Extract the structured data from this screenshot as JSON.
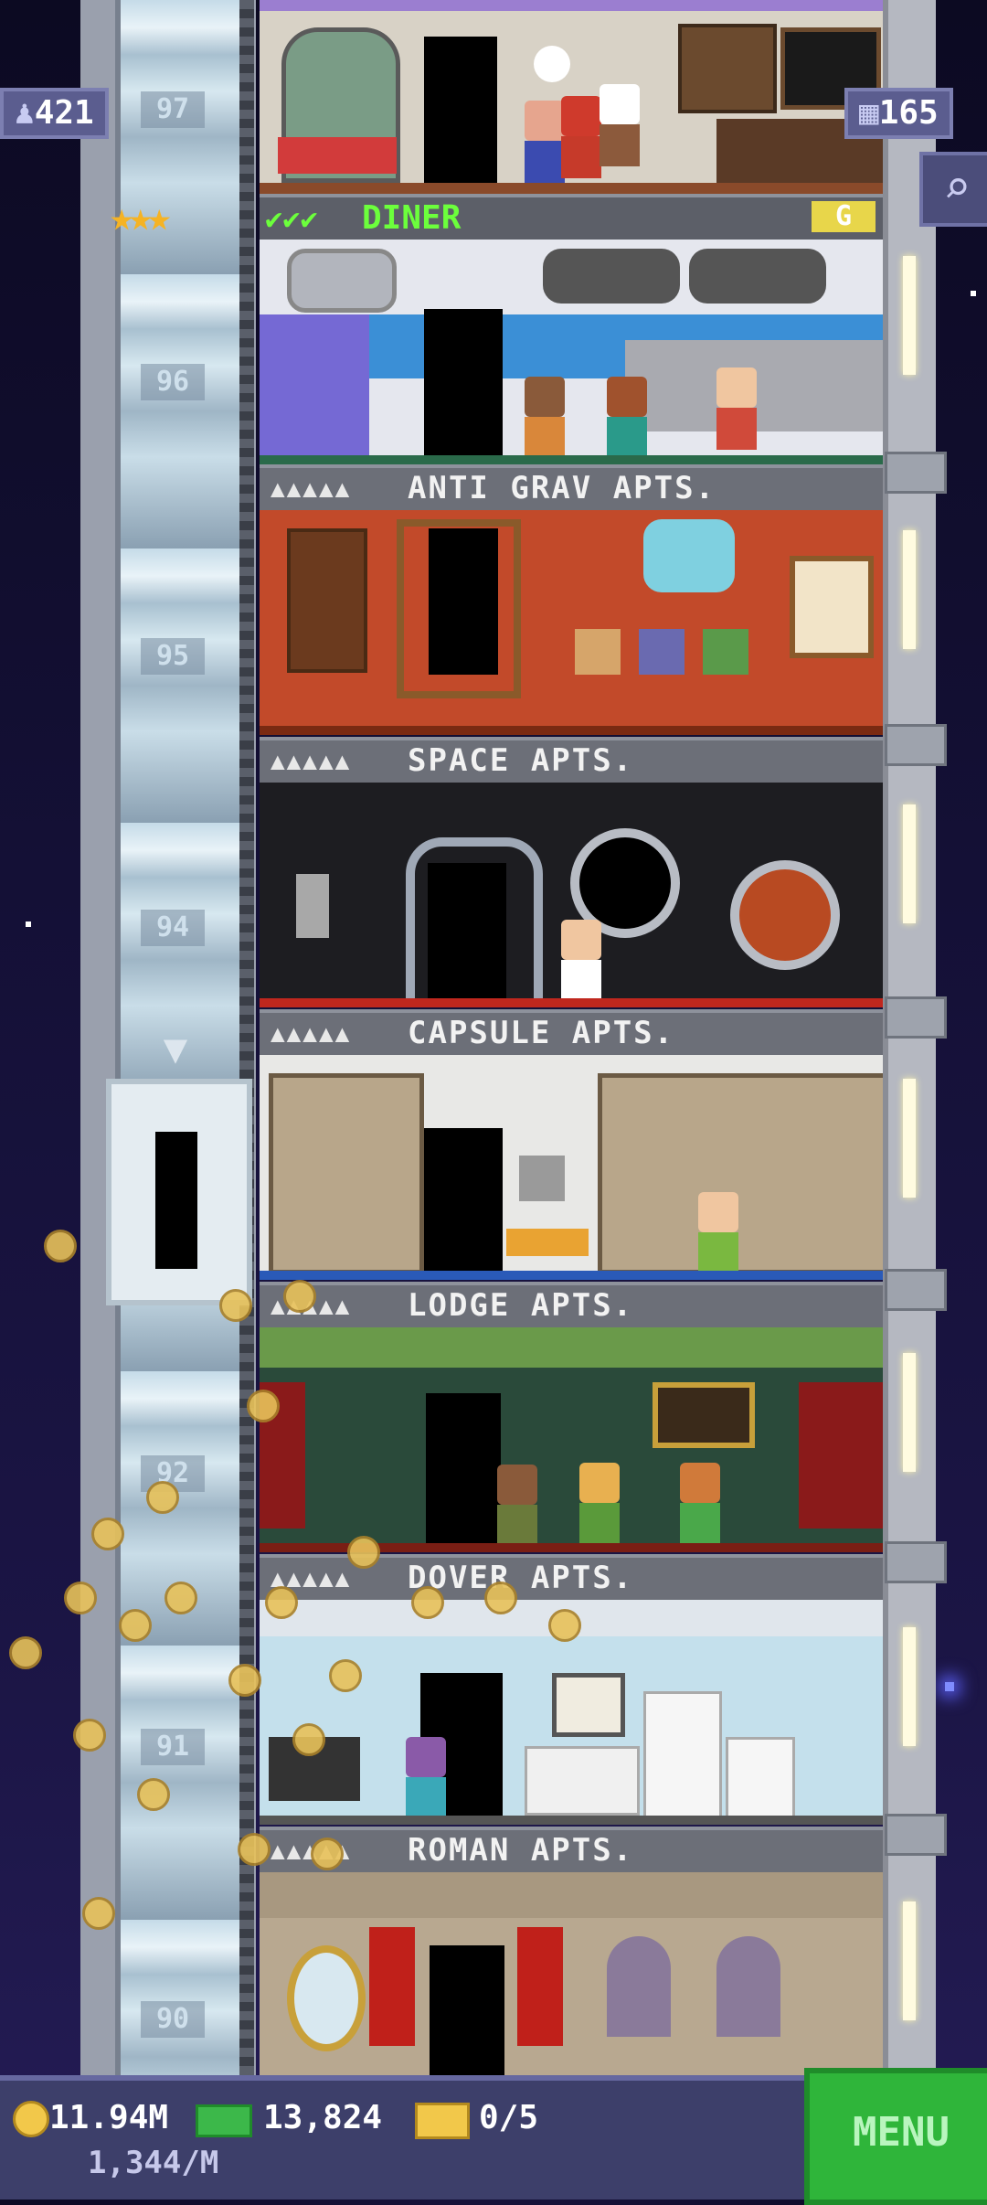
{
  "hud": {
    "population": "421",
    "floors": "165",
    "population_icon": "person-icon",
    "floors_icon": "building-icon",
    "search_icon": "magnifier-icon"
  },
  "diner": {
    "name": "DINER",
    "checks": "✔✔✔",
    "stars": "★★★",
    "stock_letter": "G"
  },
  "elevator_floors": [
    "97",
    "96",
    "95",
    "94",
    "92",
    "91",
    "90"
  ],
  "floors": [
    {
      "id": "anti-grav",
      "name": "ANTI GRAV APTS.",
      "pips": "▲▲▲▲▲"
    },
    {
      "id": "space",
      "name": "SPACE APTS.",
      "pips": "▲▲▲▲▲"
    },
    {
      "id": "capsule",
      "name": "CAPSULE APTS.",
      "pips": "▲▲▲▲▲"
    },
    {
      "id": "lodge",
      "name": "LODGE APTS.",
      "pips": "▲▲▲▲▲"
    },
    {
      "id": "dover",
      "name": "DOVER APTS.",
      "pips": "▲▲▲▲▲"
    },
    {
      "id": "roman",
      "name": "ROMAN APTS.",
      "pips": "▲▲▲▲▲"
    }
  ],
  "bottom": {
    "coins": "11.94M",
    "coin_rate": "1,344/M",
    "bux": "13,824",
    "tickets": "0/5",
    "menu_label": "MENU"
  },
  "colors": {
    "menu_green": "#2fb53a",
    "hud_purple": "#5b5d8f",
    "diner_green": "#6cff3c"
  }
}
